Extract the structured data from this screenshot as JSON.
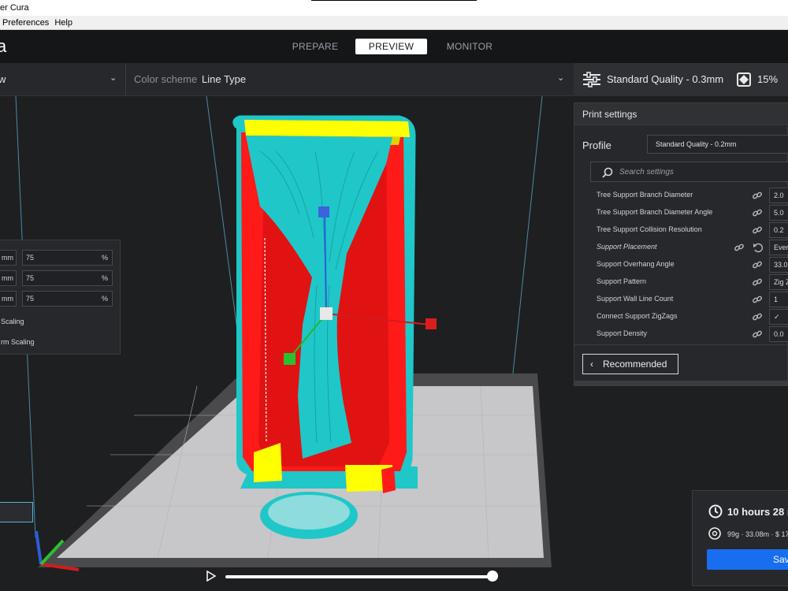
{
  "window": {
    "title": "er Cura"
  },
  "menu": {
    "items": [
      "Preferences",
      "Help"
    ]
  },
  "header": {
    "logo": "a",
    "stages": [
      {
        "label": "PREPARE"
      },
      {
        "label": "PREVIEW"
      },
      {
        "label": "MONITOR"
      }
    ]
  },
  "toolbar": {
    "view_label": "w",
    "color_scheme_label": "Color scheme",
    "color_scheme_value": "Line Type",
    "quality": "Standard Quality - 0.3mm",
    "infill": "15%"
  },
  "scale_panel": {
    "rows": [
      {
        "unit": "mm",
        "value": "75",
        "pct": "%"
      },
      {
        "unit": "mm",
        "value": "75",
        "pct": "%"
      },
      {
        "unit": "mm",
        "value": "75",
        "pct": "%"
      }
    ],
    "snap_label": "Scaling",
    "uniform_label": "rm Scaling"
  },
  "print_settings": {
    "title": "Print settings",
    "profile_label": "Profile",
    "profile_value": "Standard Quality - 0.2mm",
    "search_placeholder": "Search settings",
    "settings": [
      {
        "label": "Tree Support Branch Diameter",
        "value": "2.0",
        "italic": false,
        "reset": false
      },
      {
        "label": "Tree Support Branch Diameter Angle",
        "value": "5.0",
        "italic": false,
        "reset": false
      },
      {
        "label": "Tree Support Collision Resolution",
        "value": "0.2",
        "italic": false,
        "reset": false
      },
      {
        "label": "Support Placement",
        "value": "Ever",
        "italic": true,
        "reset": true
      },
      {
        "label": "Support Overhang Angle",
        "value": "33.0",
        "italic": false,
        "reset": false
      },
      {
        "label": "Support Pattern",
        "value": "Zig Z",
        "italic": false,
        "reset": false
      },
      {
        "label": "Support Wall Line Count",
        "value": "1",
        "italic": false,
        "reset": false
      },
      {
        "label": "Connect Support ZigZags",
        "value": "✓",
        "italic": false,
        "reset": false
      },
      {
        "label": "Support Density",
        "value": "0.0",
        "italic": false,
        "reset": false
      }
    ],
    "recommended_label": "Recommended"
  },
  "estimate": {
    "time": "10 hours 28 m",
    "material": "99g · 33.08m · $ 17.",
    "save_label": "Sav"
  },
  "simulation": {
    "progress": 1.0
  },
  "colors": {
    "accent": "#196ef0",
    "wall_red": "#ff1a1a",
    "support_cyan": "#1fc7c9",
    "skin_yellow": "#ffff00",
    "build_plate": "#c8c8c8"
  },
  "icons": [
    "settings-sliders-icon",
    "infill-icon",
    "search-icon",
    "link-icon",
    "reset-icon",
    "chevron-left-icon",
    "clock-icon",
    "filament-icon",
    "play-icon",
    "chevron-down-icon"
  ]
}
